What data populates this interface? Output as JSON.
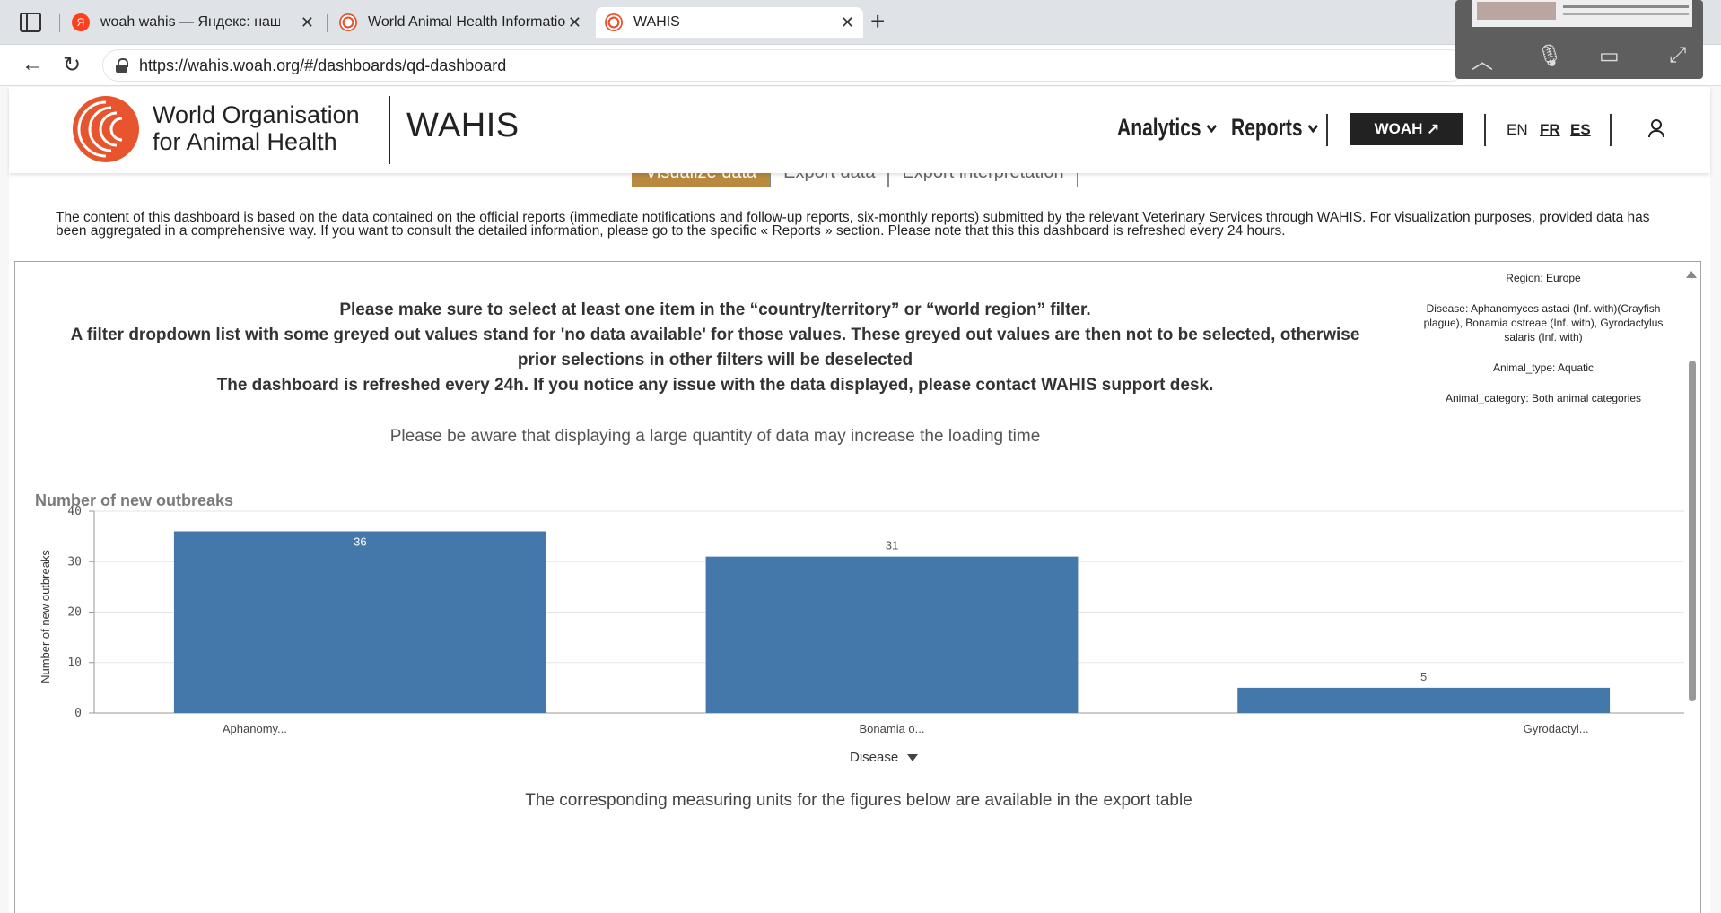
{
  "browser": {
    "tabs": [
      {
        "title": "woah wahis — Яндекс: нашлось",
        "favicon_color": "#fc3f1d",
        "favicon_letter": "Я"
      },
      {
        "title": "World Animal Health Information",
        "favicon_color": "#e8542e"
      },
      {
        "title": "WAHIS",
        "favicon_color": "#e8542e"
      }
    ],
    "url": "https://wahis.woah.org/#/dashboards/qd-dashboard"
  },
  "header": {
    "org_line1": "World Organisation",
    "org_line2": "for Animal Health",
    "title": "WAHIS",
    "nav_analytics": "Analytics",
    "nav_reports": "Reports",
    "woah_button": "WOAH ↗",
    "lang_en": "EN",
    "lang_fr": "FR",
    "lang_es": "ES"
  },
  "view_tabs": [
    "Visualize data",
    "Export data",
    "Export interpretation"
  ],
  "intro_text": "The content of this dashboard is based on the data contained on the official reports (immediate notifications and follow-up reports, six-monthly reports) submitted by the relevant Veterinary Services through WAHIS. For visualization purposes, provided data has been aggregated in a comprehensive way. If you want to consult the detailed information, please go to the specific « Reports » section. Please note that this this dashboard is refreshed every 24 hours.",
  "notice": {
    "line1": "Please make sure to select at least one item in the “country/territory” or “world region” filter.",
    "line2": "A filter dropdown list with some greyed out values stand for 'no data available' for those values. These greyed out values are then not to be selected, otherwise prior selections in other filters will be deselected",
    "line3": "The dashboard is refreshed every 24h. If you notice any issue with the data displayed, please contact WAHIS support desk."
  },
  "filters": {
    "region": "Region: Europe",
    "disease": "Disease: Aphanomyces astaci (Inf. with)(Crayfish plague), Bonamia ostreae (Inf. with), Gyrodactylus salaris (Inf. with)",
    "animal_type": "Animal_type: Aquatic",
    "animal_category": "Animal_category: Both animal categories"
  },
  "warning": "Please be aware that displaying a large quantity of data may increase the loading time",
  "chart_data": {
    "type": "bar",
    "title": "Number of new outbreaks",
    "categories": [
      "Aphanomy...",
      "Bonamia o...",
      "Gyrodactyl..."
    ],
    "values": [
      36,
      31,
      5
    ],
    "data_labels": [
      "36",
      "31",
      "5"
    ],
    "ylabel": "Number of new outbreaks",
    "xlabel": "Disease",
    "ylim": [
      0,
      40
    ],
    "yticks": [
      "0",
      "10",
      "20",
      "30",
      "40"
    ],
    "bar_color": "#4477aa",
    "grid": true
  },
  "footer_note": "The corresponding measuring units for the figures below are available in the export table"
}
